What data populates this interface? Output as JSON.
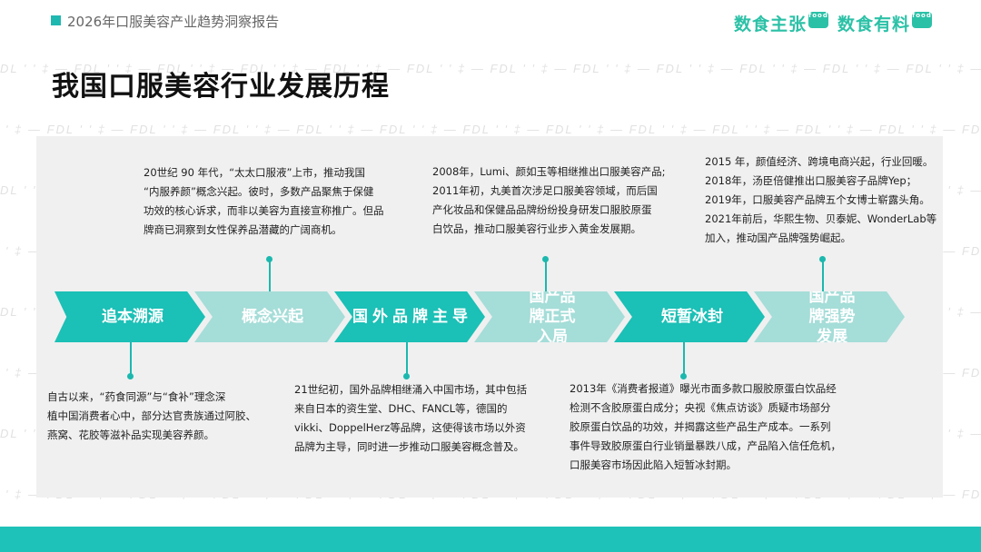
{
  "header": {
    "report_title": "2026年口服美容产业趋势洞察报告",
    "brand_1": "数食主张",
    "brand_2": "数食有料",
    "brand_badge": "food"
  },
  "watermark_text": "FDL ' ' ‡ —",
  "page_title": "我国口服美容行业发展历程",
  "colors": {
    "accent": "#1bc0b6",
    "accent_light": "#a5ddd8",
    "panel": "#f0f0f0",
    "brand": "#2bc1a7"
  },
  "stages": [
    {
      "label": "追本溯源"
    },
    {
      "label": "概念兴起"
    },
    {
      "label": "国外品牌主导"
    },
    {
      "label": "国产品牌正式入局"
    },
    {
      "label": "短暂冰封"
    },
    {
      "label": "国产品牌强势发展"
    }
  ],
  "descriptions": {
    "stage1": [
      "自古以来，“药食同源”与“食补”理念深",
      "植中国消费者心中，部分达官贵族通过阿胶、",
      "燕窝、花胶等滋补品实现美容养颜。"
    ],
    "stage2": [
      "20世纪 90 年代，“太太口服液”上市，推动我国",
      "“内服养颜”概念兴起。彼时，多数产品聚焦于保健",
      "功效的核心诉求，而非以美容为直接宣称推广。但品",
      "牌商已洞察到女性保养品潜藏的广阔商机。"
    ],
    "stage3": [
      "21世纪初，国外品牌相继涌入中国市场，其中包括",
      "来自日本的资生堂、DHC、FANCL等，德国的",
      "vikki、DoppelHerz等品牌，这使得该市场以外资",
      "品牌为主导，同时进一步推动口服美容概念普及。"
    ],
    "stage4": [
      "2008年，Lumi、颜如玉等相继推出口服美容产品;",
      "2011年初，丸美首次涉足口服美容领域，而后国",
      "产化妆品和保健品品牌纷纷投身研发口服胶原蛋",
      "白饮品，推动口服美容行业步入黄金发展期。"
    ],
    "stage5": [
      "2013年《消费者报道》曝光市面多款口服胶原蛋白饮品经",
      "检测不含胶原蛋白成分；央视《焦点访谈》质疑市场部分",
      "胶原蛋白饮品的功效，并揭露这些产品生产成本。一系列",
      "事件导致胶原蛋白行业销量暴跌八成，产品陷入信任危机，",
      "口服美容市场因此陷入短暂冰封期。"
    ],
    "stage6": [
      "2015 年，颜值经济、跨境电商兴起，行业回暖。",
      "2018年，汤臣倍健推出口服美容子品牌Yep；",
      "2019年，口服美容产品牌五个女博士崭露头角。",
      "2021年前后，华熙生物、贝泰妮、WonderLab等",
      "加入，推动国产品牌强势崛起。"
    ]
  }
}
